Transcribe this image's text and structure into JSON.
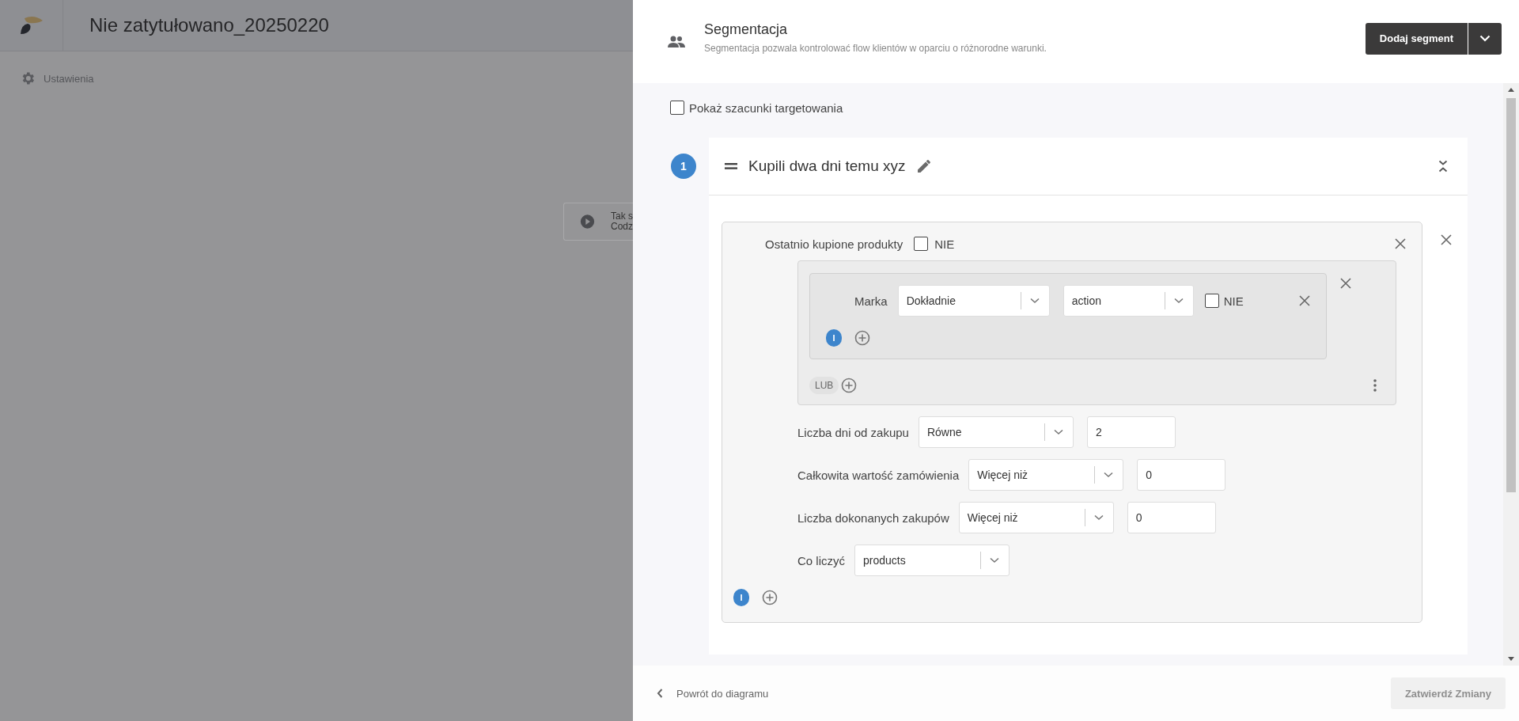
{
  "app": {
    "title": "Nie zatytułowano_20250220"
  },
  "sidebar": {
    "items": [
      {
        "label": "Ustawienia"
      }
    ]
  },
  "canvas": {
    "nodes": [
      {
        "lines": [
          "Tak s",
          "Codz"
        ]
      }
    ]
  },
  "panel": {
    "title": "Segmentacja",
    "subtitle": "Segmentacja pozwala kontrolować flow klientów w oparciu o różnorodne warunki.",
    "add_button": "Dodaj segment",
    "show_estimates": {
      "label": "Pokaż szacunki targetowania",
      "checked": false
    },
    "segments": [
      {
        "number": "1",
        "name": "Kupili dwa dni temu xyz",
        "expanded": true,
        "conditions": [
          {
            "label": "Ostatnio kupione produkty",
            "negate": {
              "label": "NIE",
              "checked": false
            },
            "groups": [
              {
                "rules": [
                  {
                    "label": "Marka",
                    "operator": "Dokładnie",
                    "value": "action",
                    "negate": {
                      "label": "NIE",
                      "checked": false
                    }
                  }
                ],
                "and_label": "I",
                "or_label": "LUB"
              }
            ],
            "fields": [
              {
                "label": "Liczba dni od zakupu",
                "operator": "Równe",
                "value": "2"
              },
              {
                "label": "Całkowita wartość zamówienia",
                "operator": "Więcej niż",
                "value": "0"
              },
              {
                "label": "Liczba dokonanych zakupów",
                "operator": "Więcej niż",
                "value": "0"
              },
              {
                "label": "Co liczyć",
                "operator": "products"
              }
            ],
            "and_label": "I"
          }
        ]
      }
    ]
  },
  "footer": {
    "back": "Powrót do diagramu",
    "confirm": {
      "label": "Zatwierdź Zmiany",
      "disabled": true
    }
  }
}
